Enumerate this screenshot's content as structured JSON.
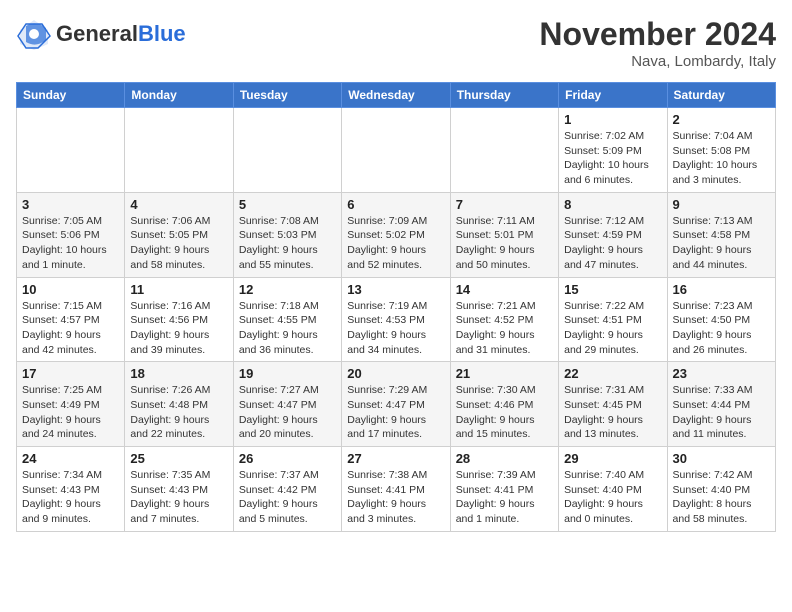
{
  "header": {
    "logo_text_general": "General",
    "logo_text_blue": "Blue",
    "month_title": "November 2024",
    "location": "Nava, Lombardy, Italy"
  },
  "days_of_week": [
    "Sunday",
    "Monday",
    "Tuesday",
    "Wednesday",
    "Thursday",
    "Friday",
    "Saturday"
  ],
  "weeks": [
    [
      {
        "day": "",
        "info": ""
      },
      {
        "day": "",
        "info": ""
      },
      {
        "day": "",
        "info": ""
      },
      {
        "day": "",
        "info": ""
      },
      {
        "day": "",
        "info": ""
      },
      {
        "day": "1",
        "info": "Sunrise: 7:02 AM\nSunset: 5:09 PM\nDaylight: 10 hours and 6 minutes."
      },
      {
        "day": "2",
        "info": "Sunrise: 7:04 AM\nSunset: 5:08 PM\nDaylight: 10 hours and 3 minutes."
      }
    ],
    [
      {
        "day": "3",
        "info": "Sunrise: 7:05 AM\nSunset: 5:06 PM\nDaylight: 10 hours and 1 minute."
      },
      {
        "day": "4",
        "info": "Sunrise: 7:06 AM\nSunset: 5:05 PM\nDaylight: 9 hours and 58 minutes."
      },
      {
        "day": "5",
        "info": "Sunrise: 7:08 AM\nSunset: 5:03 PM\nDaylight: 9 hours and 55 minutes."
      },
      {
        "day": "6",
        "info": "Sunrise: 7:09 AM\nSunset: 5:02 PM\nDaylight: 9 hours and 52 minutes."
      },
      {
        "day": "7",
        "info": "Sunrise: 7:11 AM\nSunset: 5:01 PM\nDaylight: 9 hours and 50 minutes."
      },
      {
        "day": "8",
        "info": "Sunrise: 7:12 AM\nSunset: 4:59 PM\nDaylight: 9 hours and 47 minutes."
      },
      {
        "day": "9",
        "info": "Sunrise: 7:13 AM\nSunset: 4:58 PM\nDaylight: 9 hours and 44 minutes."
      }
    ],
    [
      {
        "day": "10",
        "info": "Sunrise: 7:15 AM\nSunset: 4:57 PM\nDaylight: 9 hours and 42 minutes."
      },
      {
        "day": "11",
        "info": "Sunrise: 7:16 AM\nSunset: 4:56 PM\nDaylight: 9 hours and 39 minutes."
      },
      {
        "day": "12",
        "info": "Sunrise: 7:18 AM\nSunset: 4:55 PM\nDaylight: 9 hours and 36 minutes."
      },
      {
        "day": "13",
        "info": "Sunrise: 7:19 AM\nSunset: 4:53 PM\nDaylight: 9 hours and 34 minutes."
      },
      {
        "day": "14",
        "info": "Sunrise: 7:21 AM\nSunset: 4:52 PM\nDaylight: 9 hours and 31 minutes."
      },
      {
        "day": "15",
        "info": "Sunrise: 7:22 AM\nSunset: 4:51 PM\nDaylight: 9 hours and 29 minutes."
      },
      {
        "day": "16",
        "info": "Sunrise: 7:23 AM\nSunset: 4:50 PM\nDaylight: 9 hours and 26 minutes."
      }
    ],
    [
      {
        "day": "17",
        "info": "Sunrise: 7:25 AM\nSunset: 4:49 PM\nDaylight: 9 hours and 24 minutes."
      },
      {
        "day": "18",
        "info": "Sunrise: 7:26 AM\nSunset: 4:48 PM\nDaylight: 9 hours and 22 minutes."
      },
      {
        "day": "19",
        "info": "Sunrise: 7:27 AM\nSunset: 4:47 PM\nDaylight: 9 hours and 20 minutes."
      },
      {
        "day": "20",
        "info": "Sunrise: 7:29 AM\nSunset: 4:47 PM\nDaylight: 9 hours and 17 minutes."
      },
      {
        "day": "21",
        "info": "Sunrise: 7:30 AM\nSunset: 4:46 PM\nDaylight: 9 hours and 15 minutes."
      },
      {
        "day": "22",
        "info": "Sunrise: 7:31 AM\nSunset: 4:45 PM\nDaylight: 9 hours and 13 minutes."
      },
      {
        "day": "23",
        "info": "Sunrise: 7:33 AM\nSunset: 4:44 PM\nDaylight: 9 hours and 11 minutes."
      }
    ],
    [
      {
        "day": "24",
        "info": "Sunrise: 7:34 AM\nSunset: 4:43 PM\nDaylight: 9 hours and 9 minutes."
      },
      {
        "day": "25",
        "info": "Sunrise: 7:35 AM\nSunset: 4:43 PM\nDaylight: 9 hours and 7 minutes."
      },
      {
        "day": "26",
        "info": "Sunrise: 7:37 AM\nSunset: 4:42 PM\nDaylight: 9 hours and 5 minutes."
      },
      {
        "day": "27",
        "info": "Sunrise: 7:38 AM\nSunset: 4:41 PM\nDaylight: 9 hours and 3 minutes."
      },
      {
        "day": "28",
        "info": "Sunrise: 7:39 AM\nSunset: 4:41 PM\nDaylight: 9 hours and 1 minute."
      },
      {
        "day": "29",
        "info": "Sunrise: 7:40 AM\nSunset: 4:40 PM\nDaylight: 9 hours and 0 minutes."
      },
      {
        "day": "30",
        "info": "Sunrise: 7:42 AM\nSunset: 4:40 PM\nDaylight: 8 hours and 58 minutes."
      }
    ]
  ]
}
